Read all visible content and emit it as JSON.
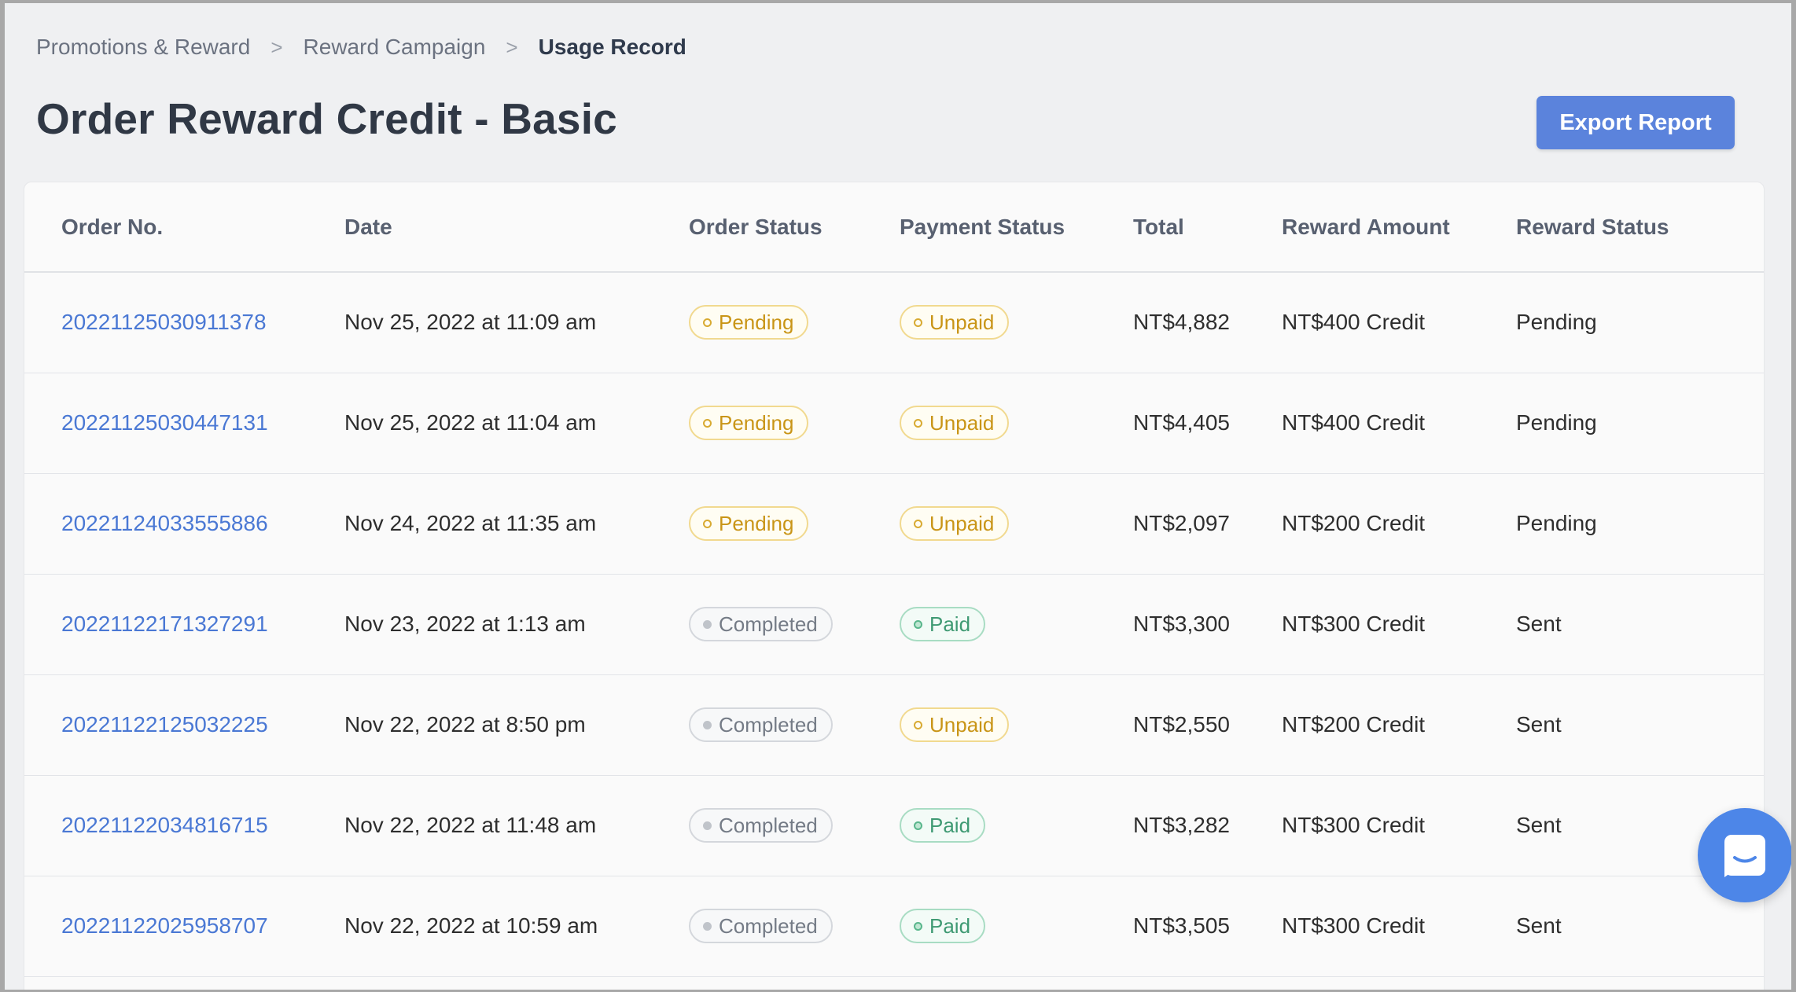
{
  "breadcrumb": {
    "items": [
      "Promotions & Reward",
      "Reward Campaign"
    ],
    "current": "Usage Record",
    "separator": ">"
  },
  "page": {
    "title": "Order Reward Credit - Basic",
    "export_label": "Export Report"
  },
  "table": {
    "headers": [
      "Order No.",
      "Date",
      "Order Status",
      "Payment Status",
      "Total",
      "Reward Amount",
      "Reward Status"
    ],
    "rows": [
      {
        "order_no": "20221125030911378",
        "date": "Nov 25, 2022 at 11:09 am",
        "order_status": "Pending",
        "payment_status": "Unpaid",
        "total": "NT$4,882",
        "reward_amount": "NT$400 Credit",
        "reward_status": "Pending"
      },
      {
        "order_no": "20221125030447131",
        "date": "Nov 25, 2022 at 11:04 am",
        "order_status": "Pending",
        "payment_status": "Unpaid",
        "total": "NT$4,405",
        "reward_amount": "NT$400 Credit",
        "reward_status": "Pending"
      },
      {
        "order_no": "20221124033555886",
        "date": "Nov 24, 2022 at 11:35 am",
        "order_status": "Pending",
        "payment_status": "Unpaid",
        "total": "NT$2,097",
        "reward_amount": "NT$200 Credit",
        "reward_status": "Pending"
      },
      {
        "order_no": "20221122171327291",
        "date": "Nov 23, 2022 at 1:13 am",
        "order_status": "Completed",
        "payment_status": "Paid",
        "total": "NT$3,300",
        "reward_amount": "NT$300 Credit",
        "reward_status": "Sent"
      },
      {
        "order_no": "20221122125032225",
        "date": "Nov 22, 2022 at 8:50 pm",
        "order_status": "Completed",
        "payment_status": "Unpaid",
        "total": "NT$2,550",
        "reward_amount": "NT$200 Credit",
        "reward_status": "Sent"
      },
      {
        "order_no": "20221122034816715",
        "date": "Nov 22, 2022 at 11:48 am",
        "order_status": "Completed",
        "payment_status": "Paid",
        "total": "NT$3,282",
        "reward_amount": "NT$300 Credit",
        "reward_status": "Sent"
      },
      {
        "order_no": "20221122025958707",
        "date": "Nov 22, 2022 at 10:59 am",
        "order_status": "Completed",
        "payment_status": "Paid",
        "total": "NT$3,505",
        "reward_amount": "NT$300 Credit",
        "reward_status": "Sent"
      }
    ]
  },
  "icons": {
    "breadcrumb_separator": "chevron-right-icon",
    "chat": "chat-bubble-icon",
    "status_dot": "status-dot-icon"
  },
  "colors": {
    "accent": "#5b83dc",
    "link": "#4a78d4",
    "pending": "#c99517",
    "paid": "#3f9a73",
    "completed": "#747b86",
    "chat": "#4d86e8"
  }
}
